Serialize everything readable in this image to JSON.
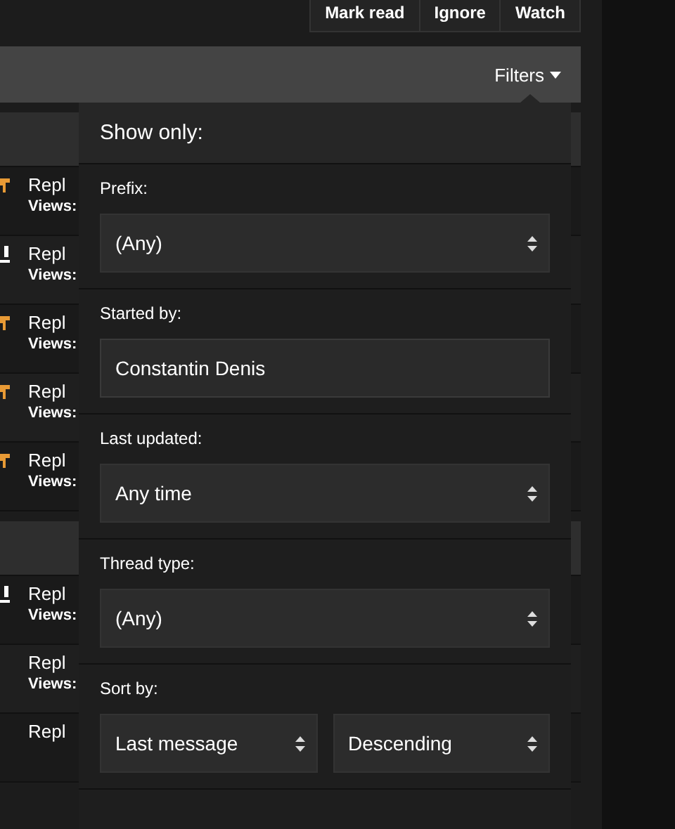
{
  "top_buttons": [
    "Mark read",
    "Ignore",
    "Watch"
  ],
  "filter_bar": {
    "label": "Filters"
  },
  "thread_sections": [
    {
      "rows": [
        {
          "kind": "sticky",
          "replies": "Repl",
          "views": "Views:"
        },
        {
          "kind": "hot",
          "replies": "Repl",
          "views": "Views:"
        },
        {
          "kind": "sticky",
          "replies": "Repl",
          "views": "Views:"
        },
        {
          "kind": "sticky",
          "replies": "Repl",
          "views": "Views:"
        },
        {
          "kind": "sticky",
          "replies": "Repl",
          "views": "Views:"
        }
      ]
    },
    {
      "rows": [
        {
          "kind": "hot",
          "replies": "Repl",
          "views": "Views:"
        },
        {
          "kind": "plain",
          "replies": "Repl",
          "views": "Views:"
        },
        {
          "kind": "plain",
          "replies": "Repl"
        }
      ]
    }
  ],
  "filter_menu": {
    "title": "Show only:",
    "fields": [
      {
        "kind": "select",
        "label": "Prefix:",
        "value": "(Any)"
      },
      {
        "kind": "input",
        "label": "Started by:",
        "value": "Constantin Denis"
      },
      {
        "kind": "select",
        "label": "Last updated:",
        "value": "Any time"
      },
      {
        "kind": "select",
        "label": "Thread type:",
        "value": "(Any)"
      },
      {
        "kind": "select-pair",
        "label": "Sort by:",
        "value": "Last message",
        "value2": "Descending"
      }
    ]
  }
}
